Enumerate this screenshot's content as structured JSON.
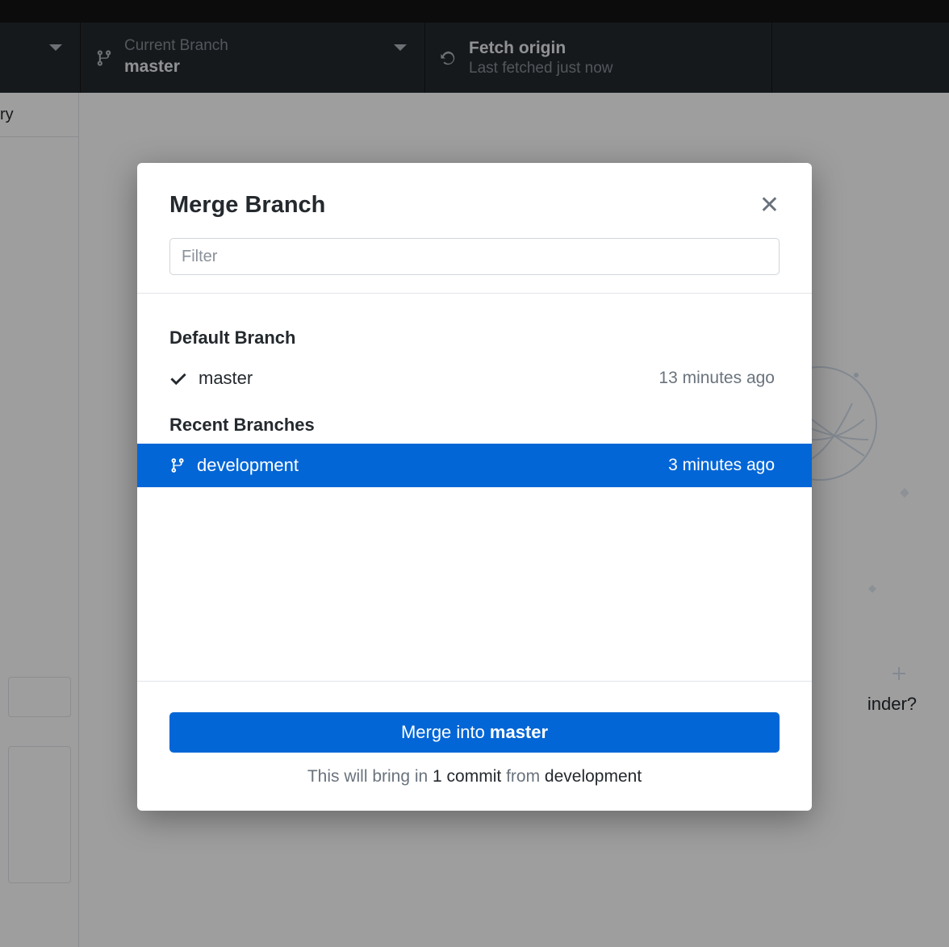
{
  "toolbar": {
    "branch": {
      "label": "Current Branch",
      "value": "master"
    },
    "fetch": {
      "label": "Fetch origin",
      "value": "Last fetched just now"
    }
  },
  "sidebar": {
    "tab_fragment": "ry"
  },
  "background": {
    "finder_fragment": "inder?"
  },
  "dialog": {
    "title": "Merge Branch",
    "filter_placeholder": "Filter",
    "sections": {
      "default": {
        "heading": "Default Branch",
        "item": {
          "name": "master",
          "time": "13 minutes ago"
        }
      },
      "recent": {
        "heading": "Recent Branches",
        "item": {
          "name": "development",
          "time": "3 minutes ago"
        }
      }
    },
    "merge_button": {
      "prefix": "Merge into ",
      "target": "master"
    },
    "hint": {
      "p1": "This will bring in ",
      "count": "1 commit",
      "p2": " from ",
      "from": "development"
    }
  }
}
